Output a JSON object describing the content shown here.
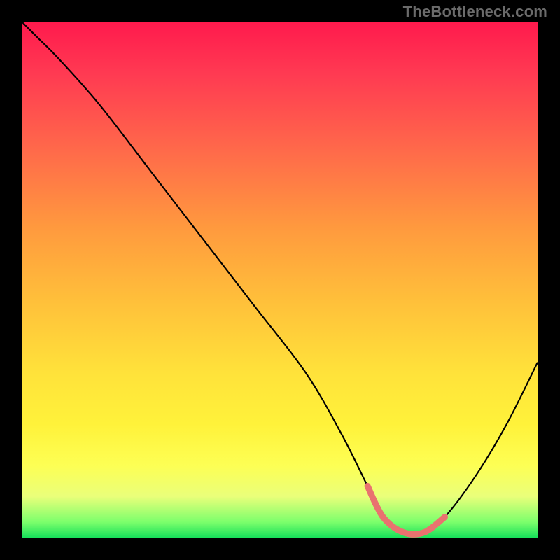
{
  "attribution": "TheBottleneck.com",
  "chart_data": {
    "type": "line",
    "title": "",
    "xlabel": "",
    "ylabel": "",
    "xlim": [
      0,
      100
    ],
    "ylim": [
      0,
      100
    ],
    "series": [
      {
        "name": "bottleneck-curve",
        "x": [
          0,
          3,
          7,
          15,
          25,
          35,
          45,
          55,
          62,
          67,
          70,
          74,
          78,
          82,
          88,
          94,
          100
        ],
        "values": [
          100,
          97,
          93,
          84,
          71,
          58,
          45,
          32,
          20,
          10,
          4,
          1,
          1,
          4,
          12,
          22,
          34
        ]
      }
    ],
    "trough_range_x": [
      67,
      82
    ],
    "gradient_stops": [
      {
        "offset": 0,
        "color": "#ff1a4d"
      },
      {
        "offset": 10,
        "color": "#ff3a52"
      },
      {
        "offset": 25,
        "color": "#ff6a4a"
      },
      {
        "offset": 40,
        "color": "#ff9a3e"
      },
      {
        "offset": 55,
        "color": "#ffc23a"
      },
      {
        "offset": 68,
        "color": "#ffe23a"
      },
      {
        "offset": 78,
        "color": "#fff23a"
      },
      {
        "offset": 86,
        "color": "#fdff54"
      },
      {
        "offset": 92,
        "color": "#eaff7a"
      },
      {
        "offset": 97,
        "color": "#7cff6c"
      },
      {
        "offset": 100,
        "color": "#18e05a"
      }
    ]
  }
}
